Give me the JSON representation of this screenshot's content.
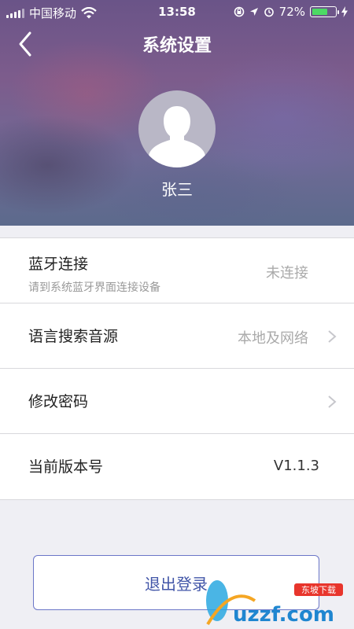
{
  "status_bar": {
    "carrier": "中国移动",
    "time": "13:58",
    "battery_percent": "72%",
    "battery_level": 0.72,
    "battery_color": "#4cd964",
    "icons": [
      "signal-icon",
      "wifi-icon",
      "rotation-lock-icon",
      "location-icon",
      "alarm-icon",
      "battery-icon",
      "charging-icon"
    ]
  },
  "nav": {
    "title": "系统设置",
    "back_icon": "back-chevron-icon"
  },
  "profile": {
    "avatar_icon": "user-silhouette-icon",
    "name": "张三"
  },
  "settings": {
    "bluetooth": {
      "label": "蓝牙连接",
      "sublabel": "请到系统蓝牙界面连接设备",
      "value": "未连接"
    },
    "voice_search": {
      "label": "语言搜索音源",
      "value": "本地及网络"
    },
    "change_password": {
      "label": "修改密码"
    },
    "version": {
      "label": "当前版本号",
      "value": "V1.1.3"
    }
  },
  "logout": {
    "label": "退出登录",
    "border_color": "#6b76c8",
    "text_color": "#4256a8"
  },
  "watermark": {
    "text": "uzzf.com",
    "badge": "东坡下载"
  }
}
